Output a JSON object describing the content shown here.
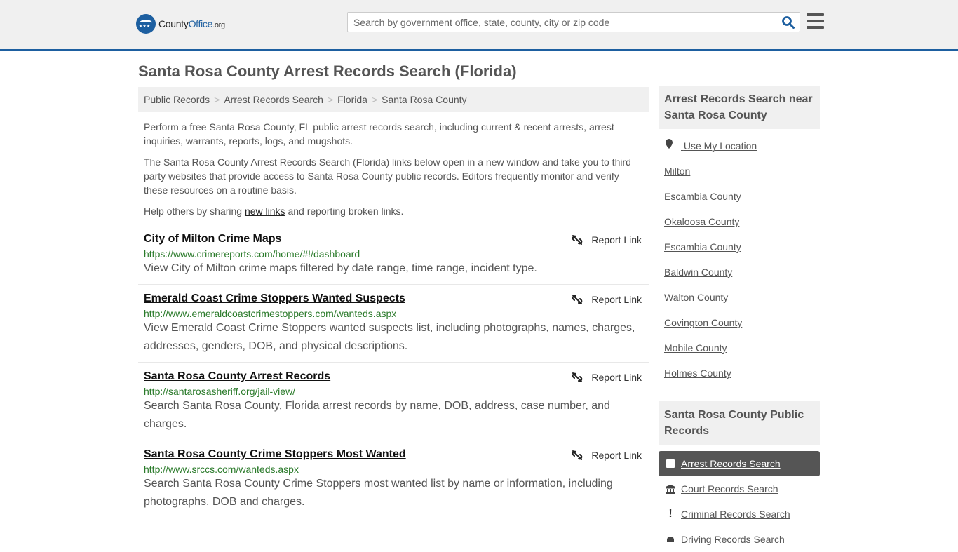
{
  "header": {
    "logo": {
      "name": "County",
      "accent": "Office",
      "tld": ".org"
    },
    "search_placeholder": "Search by government office, state, county, city or zip code"
  },
  "page_title": "Santa Rosa County Arrest Records Search (Florida)",
  "breadcrumb": [
    "Public Records",
    "Arrest Records Search",
    "Florida",
    "Santa Rosa County"
  ],
  "intro": {
    "p1": "Perform a free Santa Rosa County, FL public arrest records search, including current & recent arrests, arrest inquiries, warrants, reports, logs, and mugshots.",
    "p2": "The Santa Rosa County Arrest Records Search (Florida) links below open in a new window and take you to third party websites that provide access to Santa Rosa County public records. Editors frequently monitor and verify these resources on a routine basis.",
    "p3_pre": "Help others by sharing ",
    "p3_link": "new links",
    "p3_post": " and reporting broken links."
  },
  "report_label": "Report Link",
  "results": [
    {
      "title": "City of Milton Crime Maps",
      "url": "https://www.crimereports.com/home/#!/dashboard",
      "desc": "View City of Milton crime maps filtered by date range, time range, incident type."
    },
    {
      "title": "Emerald Coast Crime Stoppers Wanted Suspects",
      "url": "http://www.emeraldcoastcrimestoppers.com/wanteds.aspx",
      "desc": "View Emerald Coast Crime Stoppers wanted suspects list, including photographs, names, charges, addresses, genders, DOB, and physical descriptions."
    },
    {
      "title": "Santa Rosa County Arrest Records",
      "url": "http://santarosasheriff.org/jail-view/",
      "desc": "Search Santa Rosa County, Florida arrest records by name, DOB, address, case number, and charges."
    },
    {
      "title": "Santa Rosa County Crime Stoppers Most Wanted",
      "url": "http://www.srccs.com/wanteds.aspx",
      "desc": "Search Santa Rosa County Crime Stoppers most wanted list by name or information, including photographs, DOB and charges."
    }
  ],
  "sidebar": {
    "nearby_heading": "Arrest Records Search near Santa Rosa County",
    "use_location": "Use My Location",
    "nearby": [
      "Milton",
      "Escambia County",
      "Okaloosa County",
      "Escambia County",
      "Baldwin County",
      "Walton County",
      "Covington County",
      "Mobile County",
      "Holmes County"
    ],
    "public_heading": "Santa Rosa County Public Records",
    "public": [
      {
        "label": "Arrest Records Search",
        "icon": "square-icon",
        "active": true
      },
      {
        "label": "Court Records Search",
        "icon": "courthouse-icon",
        "active": false
      },
      {
        "label": "Criminal Records Search",
        "icon": "exclamation-icon",
        "active": false
      },
      {
        "label": "Driving Records Search",
        "icon": "car-icon",
        "active": false
      }
    ]
  },
  "colors": {
    "brand": "#1d5fa0",
    "url_green": "#2a7a2a",
    "active_bg": "#555555"
  }
}
